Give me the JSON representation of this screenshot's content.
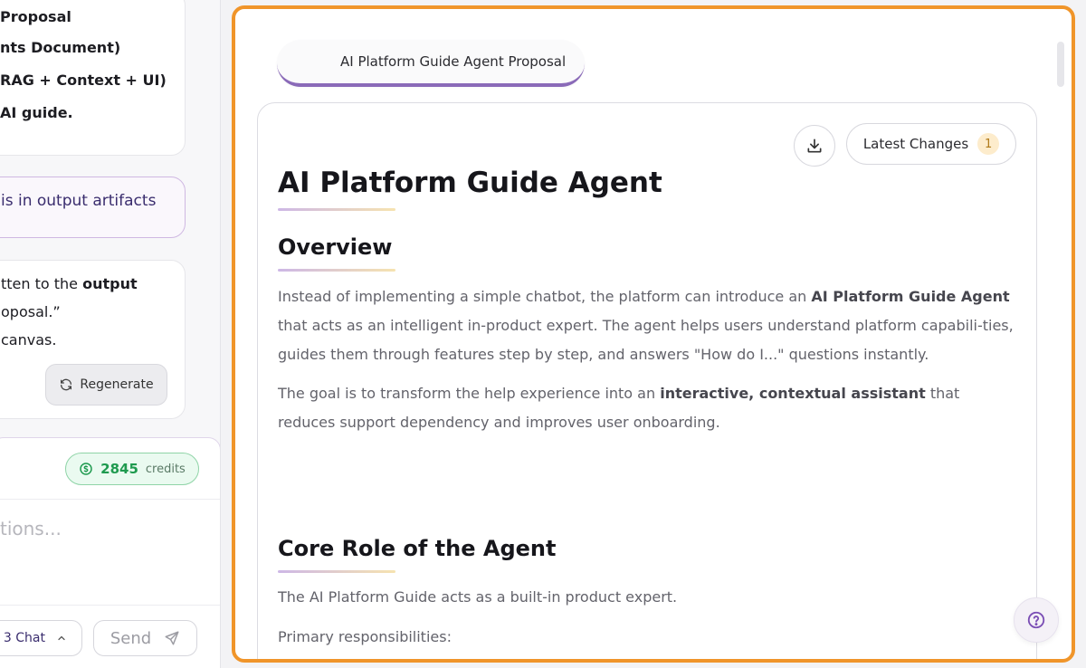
{
  "chat": {
    "msg1_lines": [
      "Proposal",
      "nts Document)",
      "RAG + Context + UI)",
      "AI guide."
    ],
    "user_bubble": "is in output artifacts",
    "msg2": {
      "line1_pre": "tten to the ",
      "line1_bold": "output",
      "line2": "oposal.”",
      "line3": "canvas."
    },
    "regenerate_label": "Regenerate",
    "credits_value": "2845",
    "credits_label": "credits",
    "input_placeholder": "tions...",
    "chat_mode_label": "3 Chat",
    "send_label": "Send"
  },
  "doc": {
    "tab_label": "AI Platform Guide Agent Proposal",
    "latest_changes_label": "Latest Changes",
    "latest_changes_count": "1",
    "title": "AI Platform Guide Agent",
    "overview_heading": "Overview",
    "overview_p1": {
      "a": "Instead of implementing a simple chatbot, the platform can introduce an ",
      "b": "AI Platform Guide Agent",
      "c": " that acts as an intelligent in-product expert. The agent helps users understand platform capabili-ties, guides them through features step by step, and answers \"How do I...\" questions instantly."
    },
    "overview_p2": {
      "a": "The goal is to transform the help experience into an ",
      "b": "interactive, contextual assistant",
      "c": " that reduces support dependency and improves user onboarding."
    },
    "core_heading": "Core Role of the Agent",
    "core_p1": "The AI Platform Guide acts as a built-in product expert.",
    "core_p2": "Primary responsibilities:"
  },
  "colors": {
    "highlight_border": "#f0952a",
    "accent_purple": "#8a6ab8",
    "credits_green": "#1f9a4f"
  }
}
